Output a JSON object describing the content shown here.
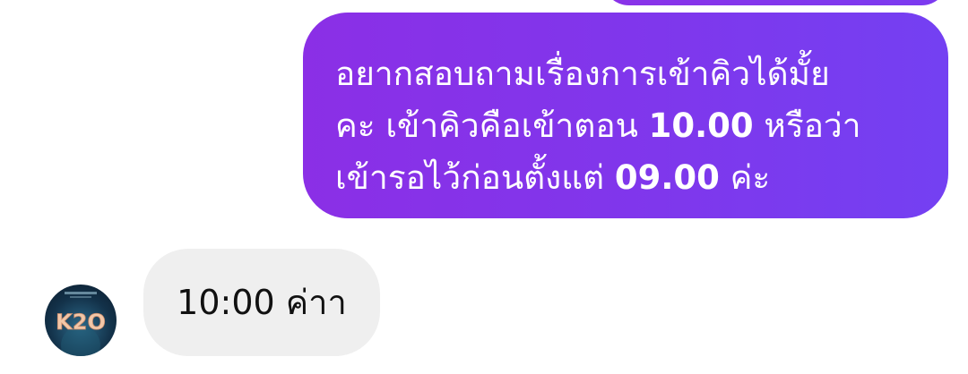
{
  "conversation": {
    "previous_message": "",
    "outgoing_message": {
      "lines": [
        [
          "อยากสอบถามเรื่องการเข้าคิวได้มั้ย",
          ""
        ],
        [
          "คะ เข้าคิวคือเข้าตอน ",
          "10.00",
          " หรือว่า"
        ],
        [
          "เข้ารอไว้ก่อนตั้งแต่ ",
          "09.00",
          " ค่ะ"
        ]
      ],
      "bubble_color": "#7f37ec"
    },
    "incoming_message": {
      "text": "10:00 ค่าา",
      "bubble_color": "#efefef",
      "avatar_label": "K2O",
      "avatar_icon": "profile-avatar-icon"
    }
  }
}
